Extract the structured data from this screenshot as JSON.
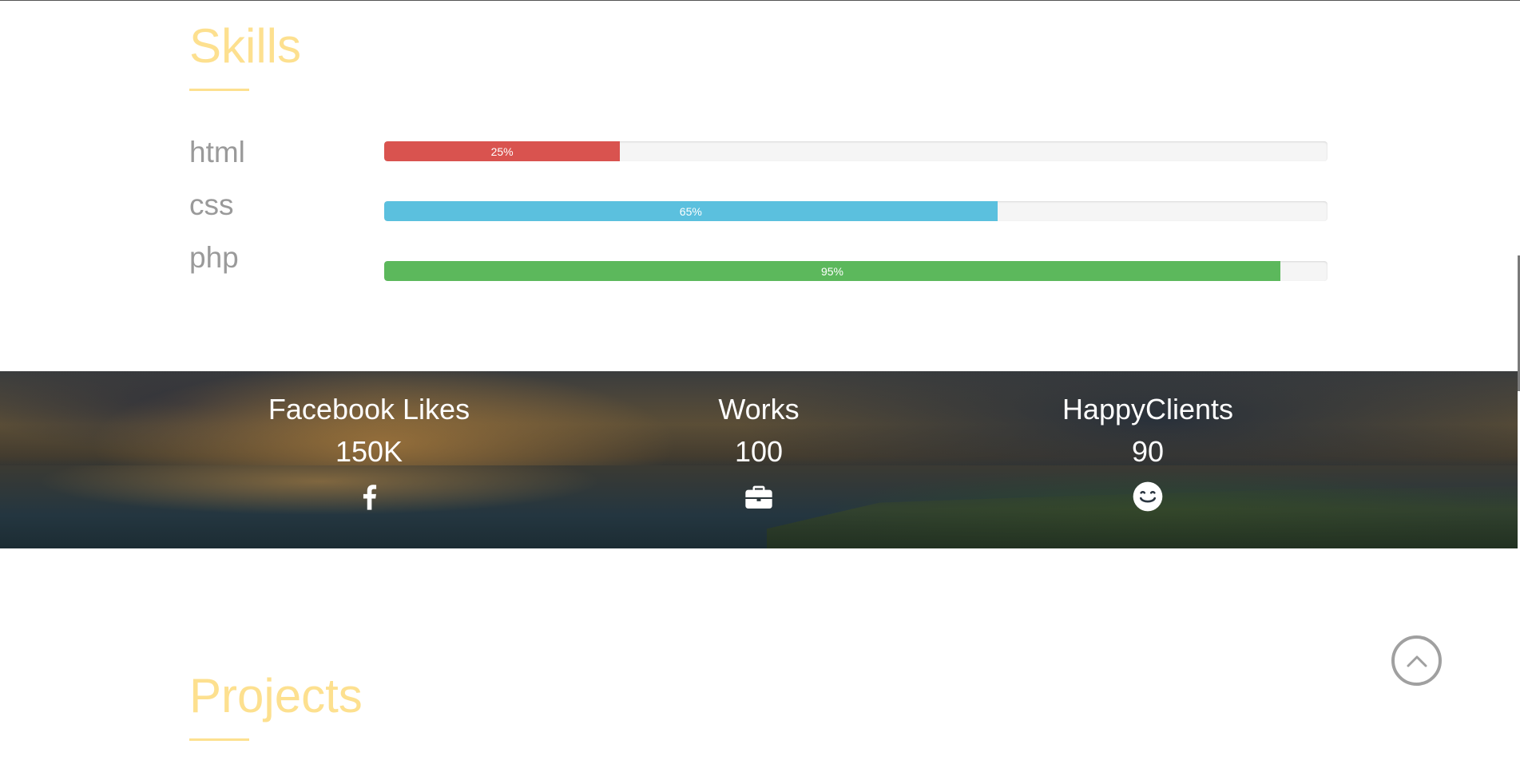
{
  "colors": {
    "title": "#fde08f",
    "html_bar": "#d9534f",
    "css_bar": "#5bc0de",
    "php_bar": "#5cb85c"
  },
  "skills": {
    "title": "Skills",
    "items": [
      {
        "label": "html",
        "percent": 25,
        "percent_label": "25%"
      },
      {
        "label": "css",
        "percent": 65,
        "percent_label": "65%"
      },
      {
        "label": "php",
        "percent": 95,
        "percent_label": "95%"
      }
    ]
  },
  "stats": [
    {
      "title": "Facebook Likes",
      "value": "150K",
      "icon": "facebook-icon"
    },
    {
      "title": "Works",
      "value": "100",
      "icon": "briefcase-icon"
    },
    {
      "title": "HappyClients",
      "value": "90",
      "icon": "smile-icon"
    }
  ],
  "projects": {
    "title": "Projects"
  },
  "scroll_top": {
    "icon": "chevron-up-icon"
  }
}
